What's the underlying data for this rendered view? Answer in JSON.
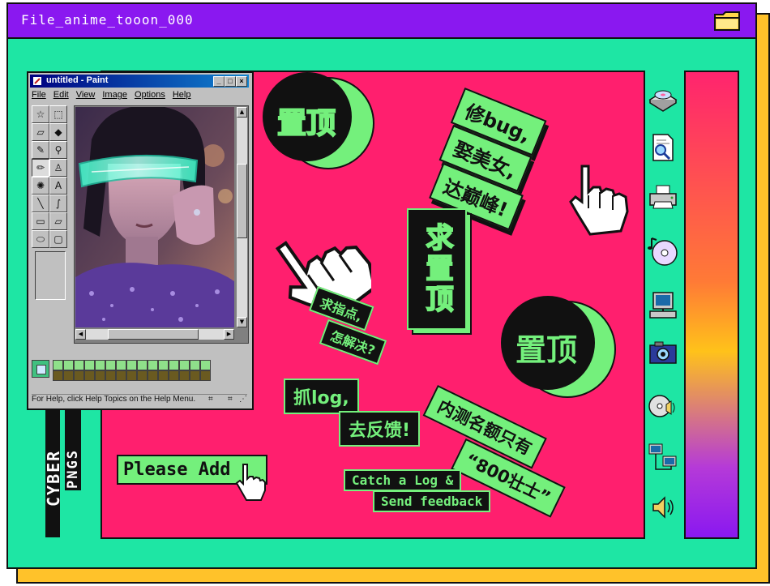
{
  "window": {
    "title": "File_anime_tooon_000",
    "folder_icon": "folder-icon",
    "brand_line1": "CYBER",
    "brand_line2": "PNGS"
  },
  "paint": {
    "title": "untitled - Paint",
    "controls": [
      "_",
      "□",
      "×"
    ],
    "menu": [
      "File",
      "Edit",
      "View",
      "Image",
      "Options",
      "Help"
    ],
    "status_text": "For Help, click Help Topics on the Help Menu."
  },
  "stickers": {
    "top_left_badge": "置顶",
    "right_badge": "置顶",
    "fix_bug_line1": "修bug,",
    "fix_bug_line2": "娶美女,",
    "fix_bug_line3": "达巅峰!",
    "vertical_badge": "求置顶",
    "ask_line1": "求指点,",
    "ask_line2": "怎解决?",
    "log_line1": "抓log,",
    "log_line2": "去反馈!",
    "beta_line1": "内测名额只有",
    "beta_line2": "“800壮士”",
    "please_add": "Please Add",
    "catch_line1": "Catch a Log &",
    "catch_line2": "Send feedback"
  },
  "sidebar_icons": [
    "disk-drive-icon",
    "search-document-icon",
    "printer-icon",
    "music-cd-icon",
    "computer-icon",
    "camera-icon",
    "cd-speaker-icon",
    "network-icon",
    "speaker-icon"
  ],
  "colors": {
    "window_bg": "#1ee6a4",
    "titlebar": "#8a18f0",
    "shadow": "#ffc22a",
    "panel": "#ff1f6e",
    "sticker": "#74f07c"
  }
}
